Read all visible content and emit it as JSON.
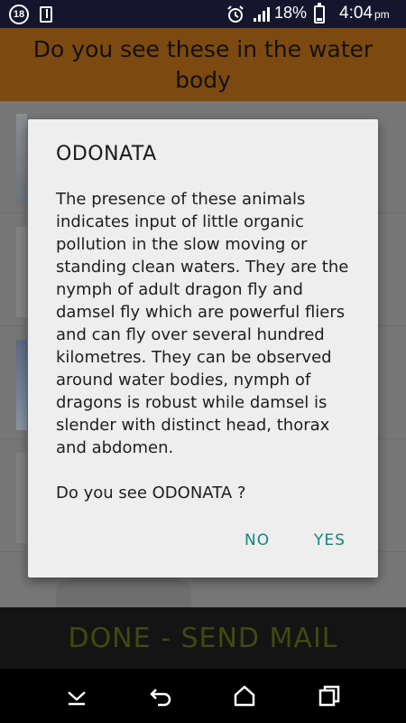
{
  "status_bar": {
    "notification_count": "18",
    "battery_percent": "18%",
    "time": "4:04",
    "time_suffix": "pm"
  },
  "header": {
    "title": "Do you see these in the water body"
  },
  "dialog": {
    "title": "ODONATA",
    "body": "The presence of these animals indicates input of little organic pollution in the slow moving or standing clean waters. They are the nymph of adult dragon fly and damsel fly which are powerful fliers and can fly over several hundred kilometres. They can be observed around water bodies, nymph of dragons is robust while damsel is slender with distinct head, thorax and abdomen.",
    "question": "Do you see ODONATA ?",
    "no_label": "NO",
    "yes_label": "YES"
  },
  "bottom_bar": {
    "done_label": "DONE - SEND MAIL"
  },
  "colors": {
    "header_bg": "#7c4a10",
    "accent": "#14857a",
    "done_text": "#3f4a10"
  },
  "icons": {
    "status": [
      "notification-badge-icon",
      "phone-icon",
      "alarm-icon",
      "signal-icon",
      "battery-icon"
    ],
    "nav": [
      "hide-keyboard-icon",
      "back-icon",
      "home-icon",
      "recents-icon"
    ]
  }
}
